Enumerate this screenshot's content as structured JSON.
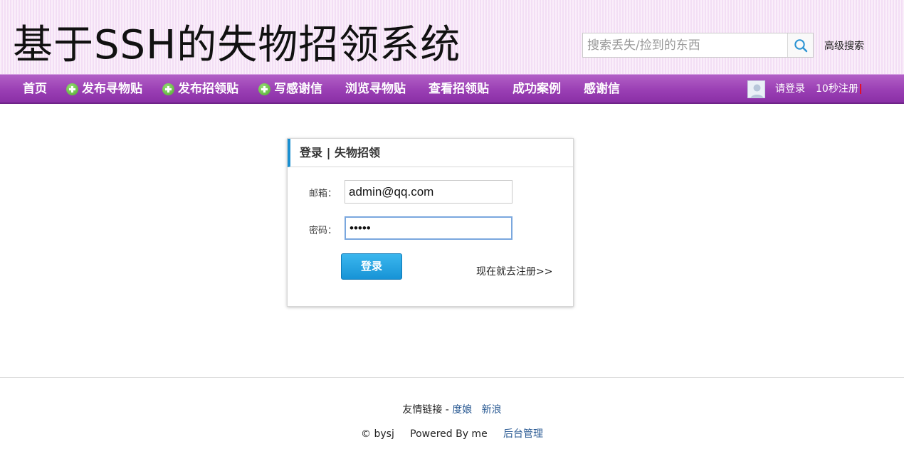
{
  "header": {
    "site_title": "基于SSH的失物招领系统",
    "search_placeholder": "搜索丢失/捡到的东西",
    "advanced_search": "高级搜索"
  },
  "nav": {
    "items": [
      {
        "label": "首页",
        "icon": null
      },
      {
        "label": "发布寻物贴",
        "icon": "plus-circle-icon"
      },
      {
        "label": "发布招领贴",
        "icon": "plus-circle-icon"
      },
      {
        "label": "写感谢信",
        "icon": "plus-circle-icon"
      },
      {
        "label": "浏览寻物贴",
        "icon": null
      },
      {
        "label": "查看招领贴",
        "icon": null
      },
      {
        "label": "成功案例",
        "icon": null
      },
      {
        "label": "感谢信",
        "icon": null
      }
    ],
    "login": "请登录",
    "register": "10秒注册"
  },
  "login_panel": {
    "title": "登录 | 失物招领",
    "email_label": "邮箱：",
    "email_value": "admin@qq.com",
    "password_label": "密码：",
    "password_value": "12345",
    "submit_label": "登录",
    "register_link": "现在就去注册>>"
  },
  "footer": {
    "links_prefix": "友情链接 -",
    "links": [
      "度娘",
      "新浪"
    ],
    "copyright": "© bysj",
    "powered": "Powered By me",
    "admin": "后台管理"
  },
  "colors": {
    "nav_bg": "#9a3fb4",
    "header_bg": "#f7e6f8",
    "accent_blue": "#1a8fd0",
    "link": "#2a5a93"
  }
}
